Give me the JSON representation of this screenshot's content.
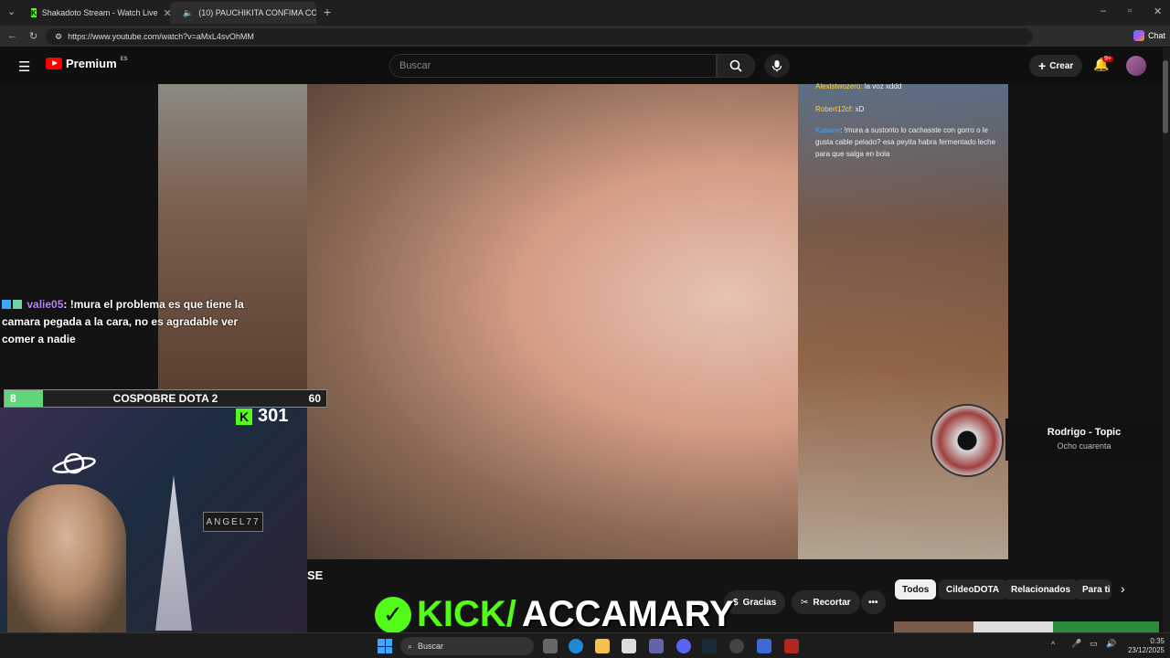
{
  "browser": {
    "tabs": [
      {
        "title": "Shakadoto Stream - Watch Live"
      },
      {
        "title": "(10) PAUCHIKITA CONFIMA CO..."
      }
    ],
    "url": "https://www.youtube.com/watch?v=aMxL4svOhMM",
    "chat_label": "Chat"
  },
  "youtube": {
    "logo_text": "Premium",
    "logo_region": "ES",
    "search_placeholder": "Buscar",
    "create_label": "Crear",
    "notification_count": "9+"
  },
  "overlay_chat": {
    "line1_user": "Alexistwozero:",
    "line1_text": "la voz xddd",
    "line2_user": "Robert12cf:",
    "line2_text": "xD",
    "line3_user": "Kusane",
    "line3_text": ": !mura a sustonto lo cachasste con gorro o le gusta cable pelado? esa peyita habra fermentado leche para que salga en bola"
  },
  "chat": {
    "username": "valie05",
    "message": ": !mura el problema es que tiene la camara pegada a la cara, no es agradable ver comer a nadie"
  },
  "vote": {
    "label": "COSPOBRE DOTA 2",
    "left_count": "8",
    "right_count": "60",
    "fill_fraction": 0.12
  },
  "viewers": {
    "count": "301",
    "icon": "kick-k-icon"
  },
  "webcam": {
    "sign_text": "ANGEL77"
  },
  "music": {
    "title": "Rodrigo - Topic",
    "subtitle": "Ocho cuarenta"
  },
  "bottom": {
    "se_text": "SE",
    "kick_banner_prefix": "KICK/",
    "kick_banner_name": "ACCAMARY",
    "actions": {
      "thanks": "Gracias",
      "clip": "Recortar"
    },
    "chips": [
      "Todos",
      "CildeoDOTA",
      "Relacionados",
      "Para ti"
    ]
  },
  "taskbar": {
    "search_placeholder": "Buscar",
    "time": "0:35",
    "date": "23/12/2025"
  },
  "colors": {
    "kick_green": "#53fc18",
    "youtube_red": "#ff0000",
    "chat_user": "#b882ff"
  }
}
